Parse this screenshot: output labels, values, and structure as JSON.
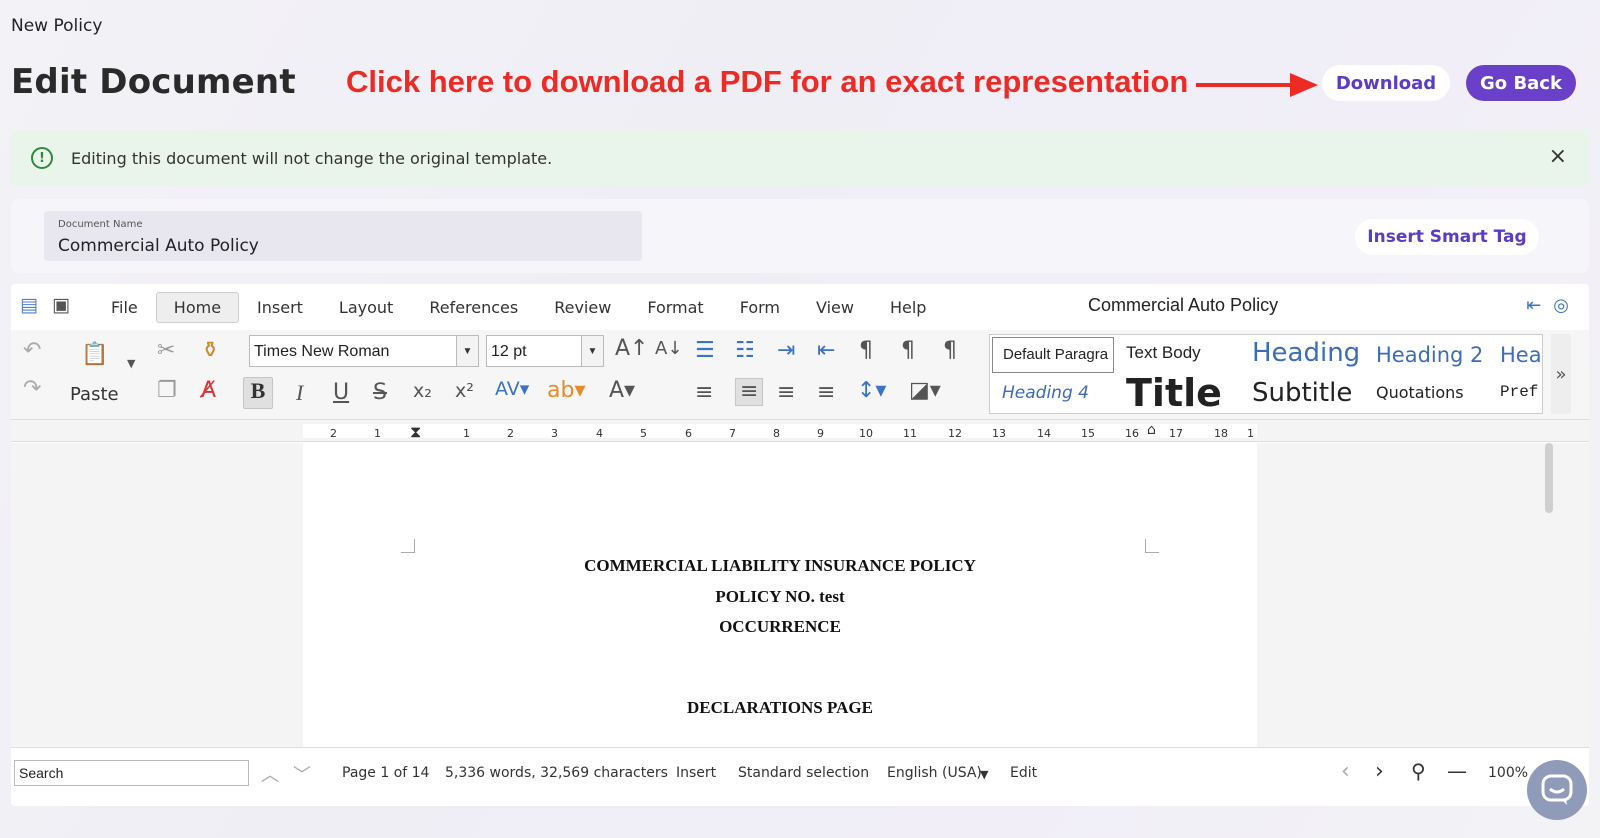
{
  "header": {
    "breadcrumb": "New Policy",
    "title": "Edit Document",
    "annotation": "Click here to download a PDF for an exact representation",
    "download_label": "Download",
    "goback_label": "Go Back"
  },
  "alert": {
    "text": "Editing this document will not change the original template.",
    "close": "×"
  },
  "document_name": {
    "label": "Document Name",
    "value": "Commercial Auto Policy",
    "smart_tag_label": "Insert Smart Tag"
  },
  "menu": {
    "items": [
      "File",
      "Home",
      "Insert",
      "Layout",
      "References",
      "Review",
      "Format",
      "Form",
      "View",
      "Help"
    ],
    "active": "Home",
    "doc_title": "Commercial Auto Policy"
  },
  "ribbon": {
    "paste_label": "Paste",
    "font_name": "Times New Roman",
    "font_size": "12 pt",
    "styles": {
      "default_paragraph": "Default Paragra",
      "text_body": "Text Body",
      "heading": "Heading",
      "heading2": "Heading 2",
      "heading_cut": "Head",
      "heading4": "Heading 4",
      "title": "Title",
      "subtitle": "Subtitle",
      "quotations": "Quotations",
      "preformatted_cut": "Pref"
    }
  },
  "ruler": {
    "labels": [
      "2",
      "1",
      "1",
      "2",
      "3",
      "4",
      "5",
      "6",
      "7",
      "8",
      "9",
      "10",
      "11",
      "12",
      "13",
      "14",
      "15",
      "16",
      "17",
      "18",
      "1"
    ]
  },
  "document": {
    "line1": "COMMERCIAL LIABILITY INSURANCE POLICY",
    "line2": "POLICY NO. test",
    "line3": "OCCURRENCE",
    "line4": "DECLARATIONS PAGE"
  },
  "statusbar": {
    "search_placeholder": "Search",
    "page": "Page 1 of 14",
    "counts": "5,336 words, 32,569 characters",
    "mode": "Insert",
    "selection": "Standard selection",
    "language": "English (USA)",
    "edit": "Edit",
    "zoom": "100%"
  },
  "colors": {
    "accent": "#6a40c9",
    "annotation": "#ee2a24",
    "alert_bg": "#e9f4ea",
    "alert_icon": "#2e8b3e"
  }
}
